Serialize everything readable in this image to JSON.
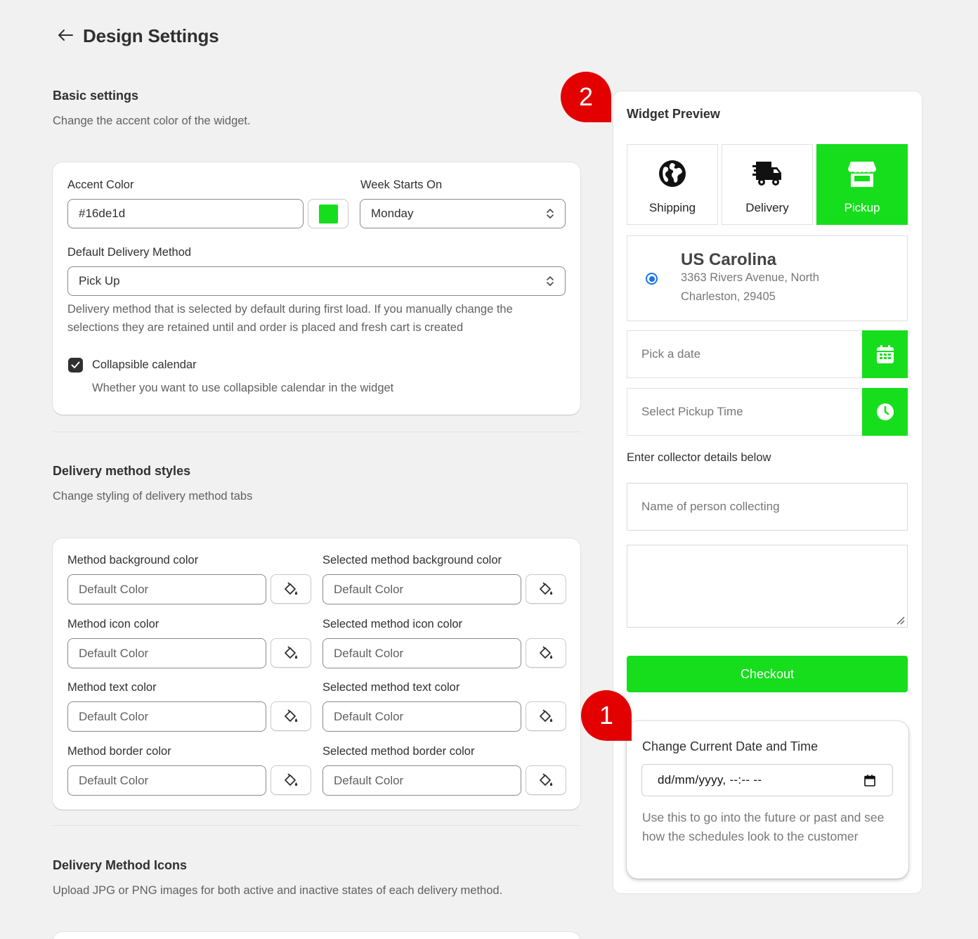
{
  "header": {
    "title": "Design Settings"
  },
  "basic": {
    "title": "Basic settings",
    "description": "Change the accent color of the widget.",
    "accent_label": "Accent Color",
    "accent_value": "#16de1d",
    "accent_color": "#16de1d",
    "week_label": "Week Starts On",
    "week_value": "Monday",
    "default_method_label": "Default Delivery Method",
    "default_method_value": "Pick Up",
    "default_method_help": "Delivery method that is selected by default during first load. If you manually change the selections they are retained until and order is placed and fresh cart is created",
    "collapsible_label": "Collapsible calendar",
    "collapsible_help": "Whether you want to use collapsible calendar in the widget",
    "collapsible_checked": true
  },
  "styles": {
    "title": "Delivery method styles",
    "description": "Change styling of delivery method tabs",
    "fields": [
      {
        "label": "Method background color",
        "placeholder": "Default Color"
      },
      {
        "label": "Selected method background color",
        "placeholder": "Default Color"
      },
      {
        "label": "Method icon color",
        "placeholder": "Default Color"
      },
      {
        "label": "Selected method icon color",
        "placeholder": "Default Color"
      },
      {
        "label": "Method text color",
        "placeholder": "Default Color"
      },
      {
        "label": "Selected method text color",
        "placeholder": "Default Color"
      },
      {
        "label": "Method border color",
        "placeholder": "Default Color"
      },
      {
        "label": "Selected method border color",
        "placeholder": "Default Color"
      }
    ]
  },
  "icons_section": {
    "title": "Delivery Method Icons",
    "description": "Upload JPG or PNG images for both active and inactive states of each delivery method."
  },
  "preview": {
    "title": "Widget Preview",
    "tabs": [
      {
        "label": "Shipping",
        "icon": "globe-icon",
        "active": false
      },
      {
        "label": "Delivery",
        "icon": "truck-icon",
        "active": false
      },
      {
        "label": "Pickup",
        "icon": "store-icon",
        "active": true
      }
    ],
    "location": {
      "name": "US Carolina",
      "address": "3363 Rivers Avenue, North Charleston, 29405"
    },
    "date_placeholder": "Pick a date",
    "time_placeholder": "Select Pickup Time",
    "collector_label": "Enter collector details below",
    "name_placeholder": "Name of person collecting",
    "checkout_label": "Checkout"
  },
  "datetime": {
    "title": "Change Current Date and Time",
    "input_value": "dd/mm/yyyy, --:-- --",
    "help": "Use this to go into the future or past and see how the schedules look to the customer"
  },
  "badges": {
    "one": "1",
    "two": "2"
  },
  "colors": {
    "accent": "#16de1d",
    "badge": "#e20000",
    "radio": "#1a73e8"
  }
}
